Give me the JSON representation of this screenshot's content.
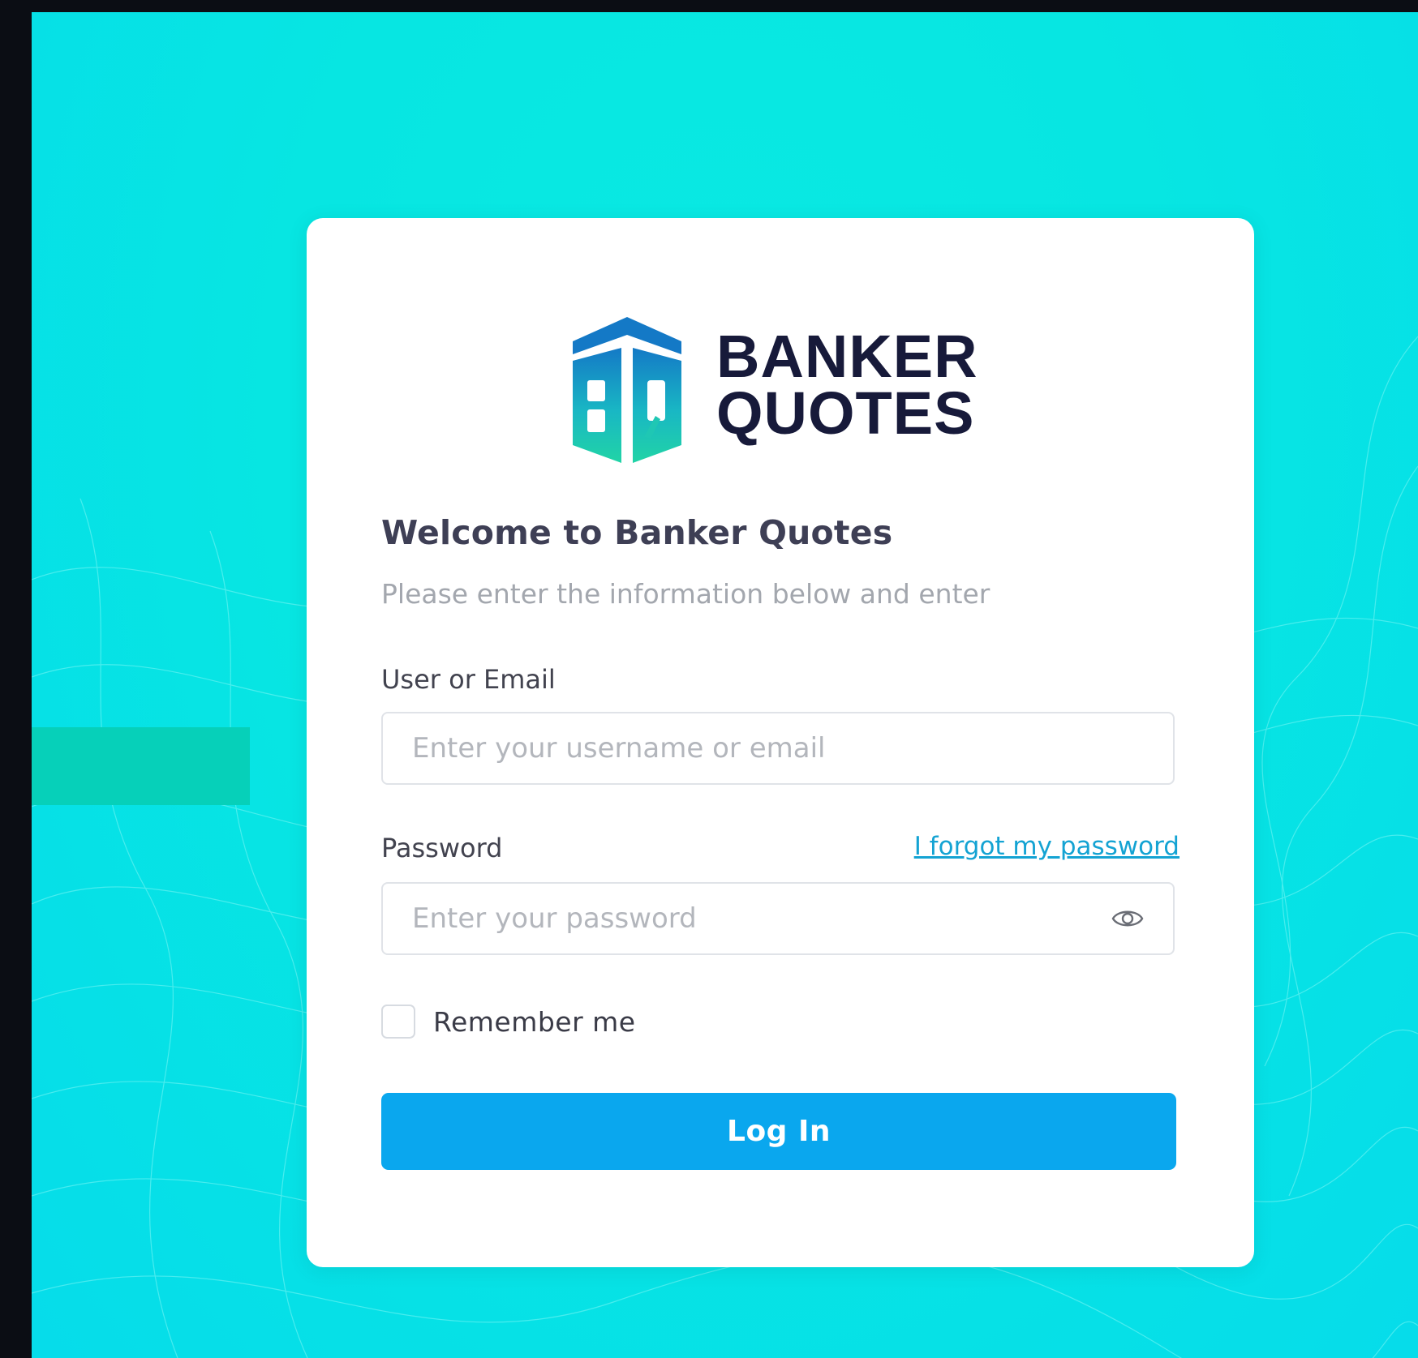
{
  "brand": {
    "name_line1": "BANKER",
    "name_line2": "QUOTES",
    "accent_color": "#0aa7ee",
    "logo_colors": [
      "#1479c6",
      "#19b7c4",
      "#21d4a6"
    ]
  },
  "form": {
    "title": "Welcome to Banker Quotes",
    "subtitle": "Please enter the information below and enter",
    "user_label": "User or Email",
    "user_placeholder": "Enter your username or email",
    "user_value": "",
    "password_label": "Password",
    "forgot_link": "I forgot my password",
    "password_placeholder": "Enter your password",
    "password_value": "",
    "show_password_icon": "eye-icon",
    "remember_label": "Remember me",
    "remember_checked": false,
    "login_label": "Log In"
  },
  "colors": {
    "background": "#07e6e2",
    "side_accent": "#06d0b9",
    "outer_frame": "#0b0d14"
  }
}
